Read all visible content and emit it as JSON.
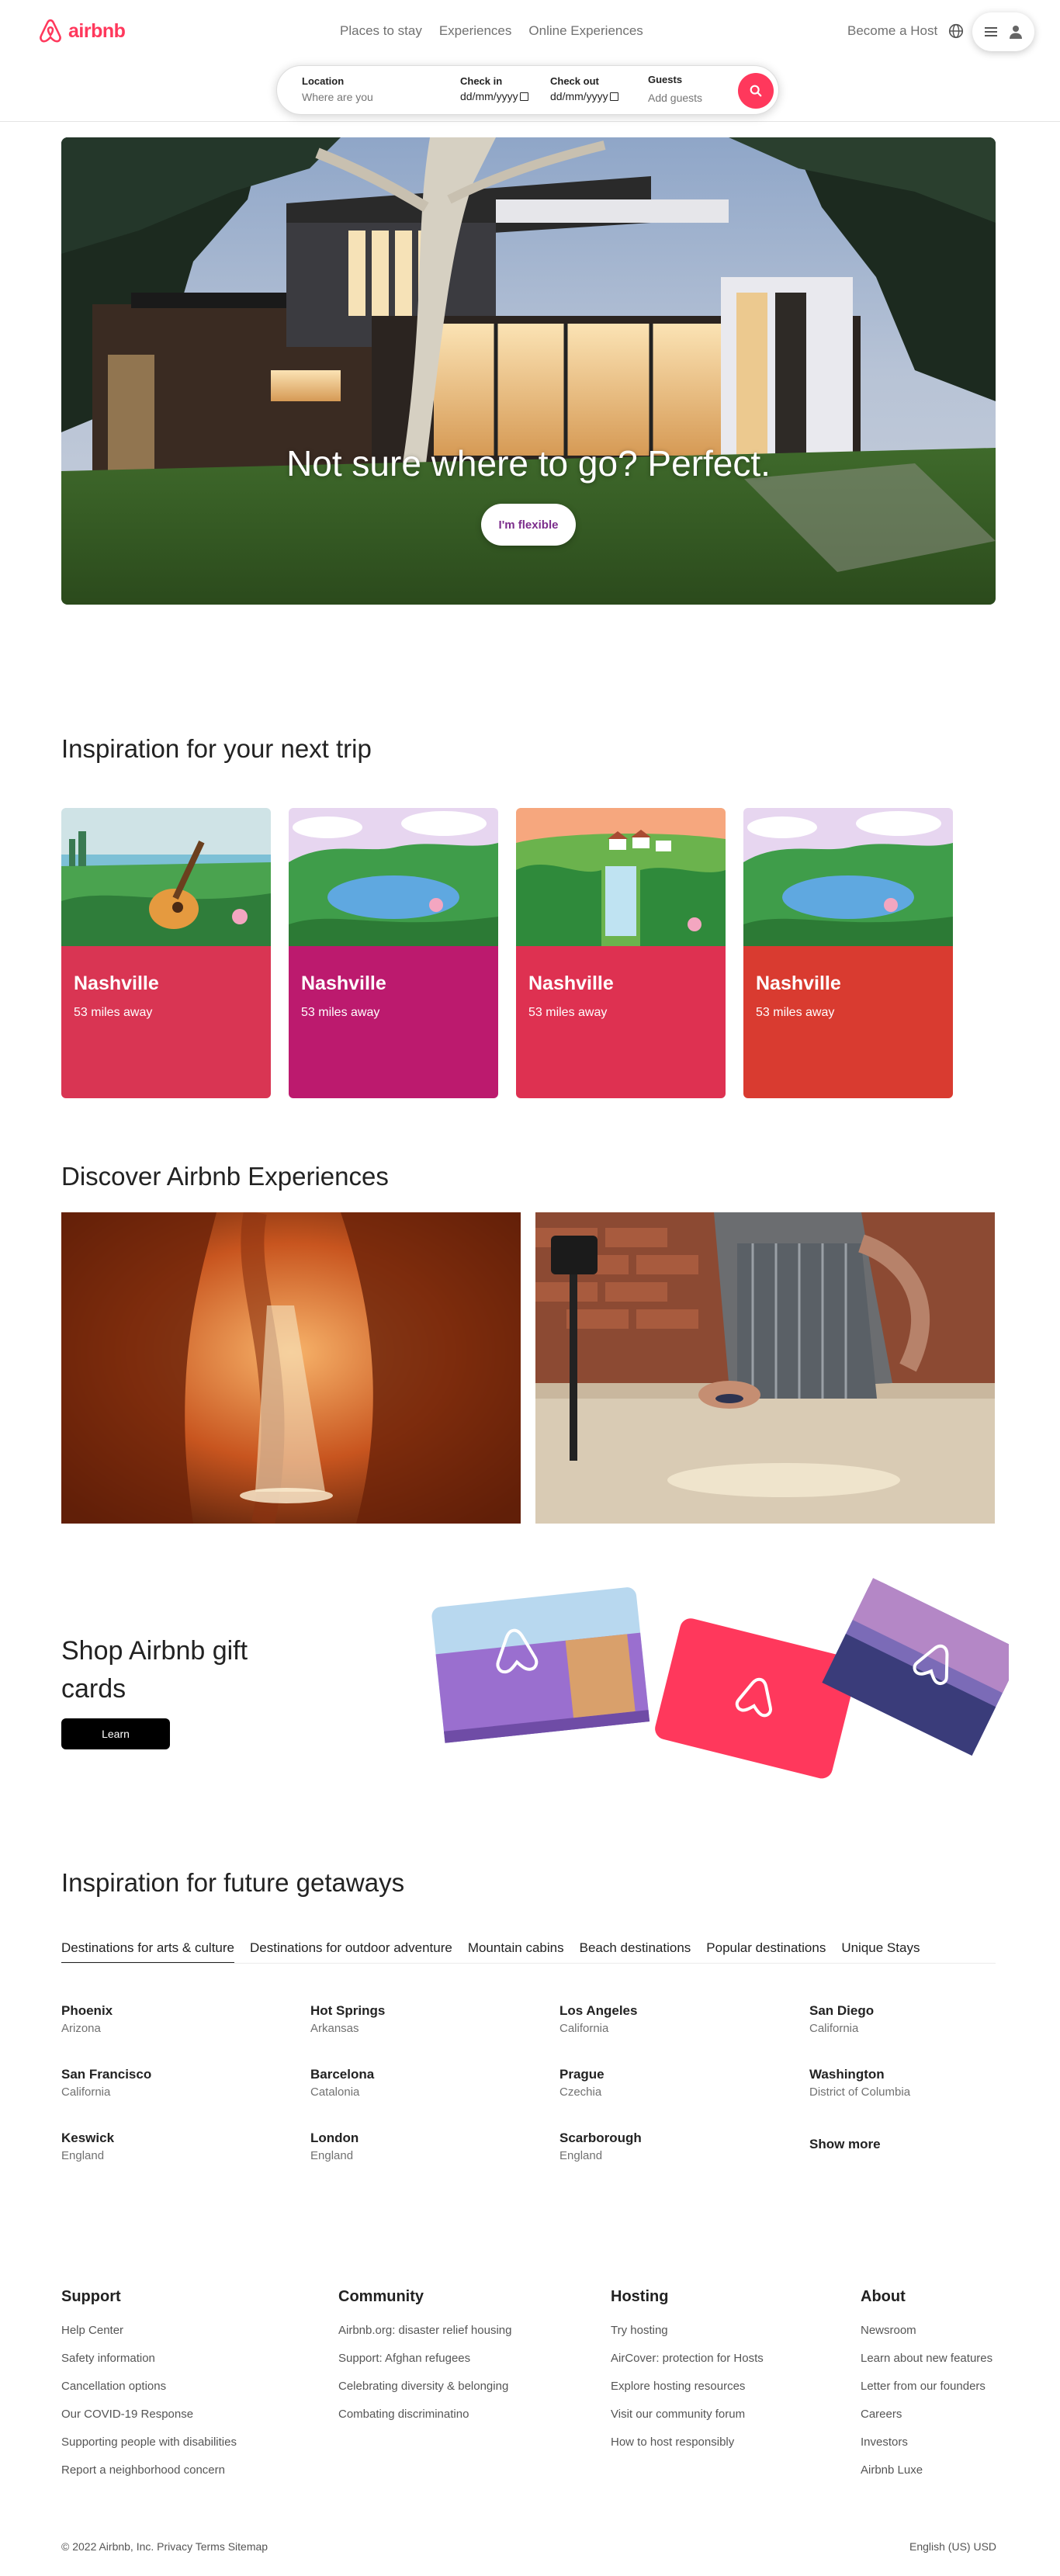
{
  "header": {
    "brand": "airbnb",
    "nav": [
      "Places to stay",
      "Experiences",
      "Online Experiences"
    ],
    "host_link": "Become a Host"
  },
  "search": {
    "location_label": "Location",
    "location_placeholder": "Where are you",
    "checkin_label": "Check in",
    "checkin_value": "dd/mm/yyyy",
    "checkout_label": "Check out",
    "checkout_value": "dd/mm/yyyy",
    "guests_label": "Guests",
    "guests_placeholder": "Add guests"
  },
  "hero": {
    "title": "Not sure where to go? Perfect.",
    "button": "I'm flexible"
  },
  "inspiration": {
    "title": "Inspiration for your next trip",
    "cards": [
      {
        "name": "Nashville",
        "distance": "53 miles away",
        "color": "#d93553"
      },
      {
        "name": "Nashville",
        "distance": "53 miles away",
        "color": "#bc1a6e"
      },
      {
        "name": "Nashville",
        "distance": "53 miles away",
        "color": "#de3151"
      },
      {
        "name": "Nashville",
        "distance": "53 miles away",
        "color": "#d93b30"
      }
    ]
  },
  "experiences": {
    "title": "Discover Airbnb Experiences"
  },
  "gift": {
    "title": "Shop Airbnb gift cards",
    "button": "Learn"
  },
  "getaways": {
    "title": "Inspiration for future getaways",
    "tabs": [
      "Destinations for arts & culture",
      "Destinations for outdoor adventure",
      "Mountain cabins",
      "Beach destinations",
      "Popular destinations",
      "Unique Stays"
    ],
    "destinations": [
      {
        "name": "Phoenix",
        "region": "Arizona"
      },
      {
        "name": "Hot Springs",
        "region": "Arkansas"
      },
      {
        "name": "Los Angeles",
        "region": "California"
      },
      {
        "name": "San Diego",
        "region": "California"
      },
      {
        "name": "San Francisco",
        "region": "California"
      },
      {
        "name": "Barcelona",
        "region": "Catalonia"
      },
      {
        "name": "Prague",
        "region": "Czechia"
      },
      {
        "name": "Washington",
        "region": "District of Columbia"
      },
      {
        "name": "Keswick",
        "region": "England"
      },
      {
        "name": "London",
        "region": "England"
      },
      {
        "name": "Scarborough",
        "region": "England"
      }
    ],
    "show_more": "Show more"
  },
  "footer": {
    "columns": [
      {
        "title": "Support",
        "links": [
          "Help Center",
          "Safety information",
          "Cancellation options",
          "Our COVID-19 Response",
          "Supporting people with disabilities",
          "Report a neighborhood concern"
        ]
      },
      {
        "title": "Community",
        "links": [
          "Airbnb.org: disaster relief housing",
          "Support: Afghan refugees",
          "Celebrating diversity & belonging",
          "Combating discriminatino"
        ]
      },
      {
        "title": "Hosting",
        "links": [
          "Try hosting",
          "AirCover: protection for Hosts",
          "Explore hosting resources",
          "Visit our community forum",
          "How to host responsibly"
        ]
      },
      {
        "title": "About",
        "links": [
          "Newsroom",
          "Learn about new features",
          "Letter from our founders",
          "Careers",
          "Investors",
          "Airbnb Luxe"
        ]
      }
    ],
    "copyright": "© 2022 Airbnb, Inc. Privacy Terms Sitemap",
    "language": "English (US) USD"
  }
}
